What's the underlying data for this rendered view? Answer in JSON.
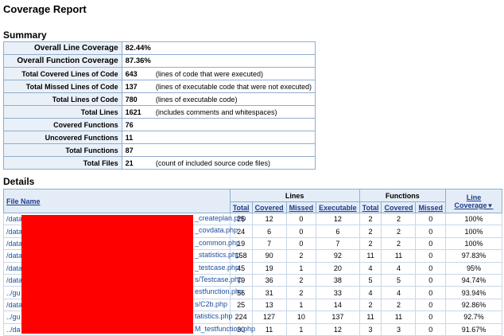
{
  "title": "Coverage Report",
  "summary_heading": "Summary",
  "summary": [
    {
      "label": "Overall Line Coverage",
      "value": "82.44%",
      "note": ""
    },
    {
      "label": "Overall Function Coverage",
      "value": "87.36%",
      "note": ""
    },
    {
      "label": "Total Covered Lines of Code",
      "value": "643",
      "note": "(lines of code that were executed)"
    },
    {
      "label": "Total Missed Lines of Code",
      "value": "137",
      "note": "(lines of executable code that were not executed)"
    },
    {
      "label": "Total Lines of Code",
      "value": "780",
      "note": "(lines of executable code)"
    },
    {
      "label": "Total Lines",
      "value": "1621",
      "note": "(includes comments and whitespaces)"
    },
    {
      "label": "Covered Functions",
      "value": "76",
      "note": ""
    },
    {
      "label": "Uncovered Functions",
      "value": "11",
      "note": ""
    },
    {
      "label": "Total Functions",
      "value": "87",
      "note": ""
    },
    {
      "label": "Total Files",
      "value": "21",
      "note": "(count of included source code files)"
    }
  ],
  "details_heading": "Details",
  "details": {
    "headers": {
      "file_name": "File Name",
      "lines": "Lines",
      "functions": "Functions",
      "line_coverage": "Line Coverage",
      "total": "Total",
      "covered": "Covered",
      "missed": "Missed",
      "executable": "Executable",
      "sort_icon": "▼"
    },
    "rows": [
      {
        "pre": "/data",
        "post": "_createplan.php",
        "lt": "25",
        "lc": "12",
        "lm": "0",
        "le": "12",
        "ft": "2",
        "fc": "2",
        "fm": "0",
        "cov": "100%"
      },
      {
        "pre": "/data",
        "post": "_covdata.php",
        "lt": "24",
        "lc": "6",
        "lm": "0",
        "le": "6",
        "ft": "2",
        "fc": "2",
        "fm": "0",
        "cov": "100%"
      },
      {
        "pre": "/data",
        "post": "_common.php",
        "lt": "19",
        "lc": "7",
        "lm": "0",
        "le": "7",
        "ft": "2",
        "fc": "2",
        "fm": "0",
        "cov": "100%"
      },
      {
        "pre": "/data",
        "post": "_statistics.php",
        "lt": "158",
        "lc": "90",
        "lm": "2",
        "le": "92",
        "ft": "11",
        "fc": "11",
        "fm": "0",
        "cov": "97.83%"
      },
      {
        "pre": "/data",
        "post": "_testcase.php",
        "lt": "45",
        "lc": "19",
        "lm": "1",
        "le": "20",
        "ft": "4",
        "fc": "4",
        "fm": "0",
        "cov": "95%"
      },
      {
        "pre": "/data",
        "post": "s/Testcase.php",
        "lt": "79",
        "lc": "36",
        "lm": "2",
        "le": "38",
        "ft": "5",
        "fc": "5",
        "fm": "0",
        "cov": "94.74%"
      },
      {
        "pre": "../gu",
        "post": "estfunction.php",
        "lt": "56",
        "lc": "31",
        "lm": "2",
        "le": "33",
        "ft": "4",
        "fc": "4",
        "fm": "0",
        "cov": "93.94%"
      },
      {
        "pre": "/data",
        "post": "s/C2b.php",
        "lt": "25",
        "lc": "13",
        "lm": "1",
        "le": "14",
        "ft": "2",
        "fc": "2",
        "fm": "0",
        "cov": "92.86%"
      },
      {
        "pre": "../gu",
        "post": "tatistics.php",
        "lt": "224",
        "lc": "127",
        "lm": "10",
        "le": "137",
        "ft": "11",
        "fc": "11",
        "fm": "0",
        "cov": "92.7%"
      },
      {
        "pre": "../da",
        "post": "M_testfunction.php",
        "lt": "30",
        "lc": "11",
        "lm": "1",
        "le": "12",
        "ft": "3",
        "fc": "3",
        "fm": "0",
        "cov": "91.67%"
      }
    ]
  },
  "colors": {
    "header_bg": "#e4edf7",
    "border": "#8faecf",
    "link": "#1f4f9c",
    "redaction": "#ff0000"
  }
}
